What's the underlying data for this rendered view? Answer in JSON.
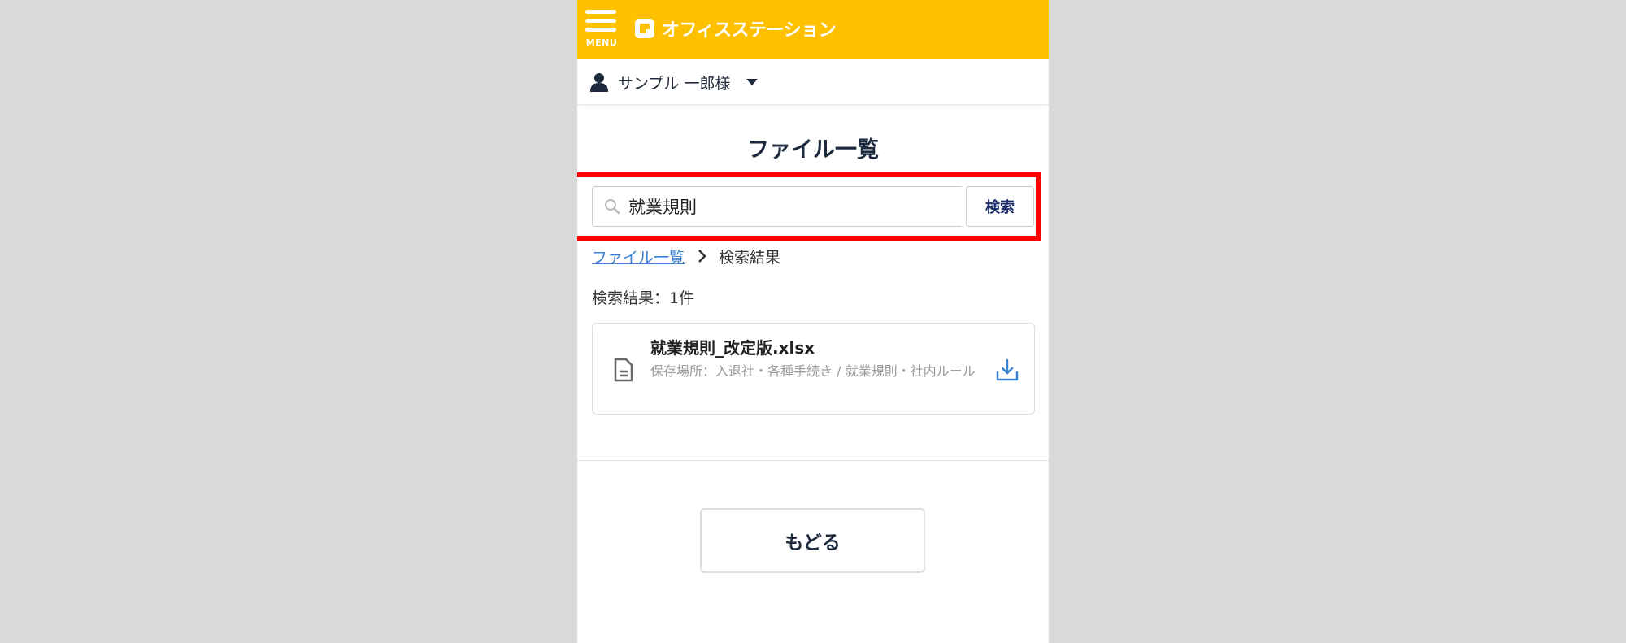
{
  "header": {
    "menu_label": "MENU",
    "logo_text": "オフィスステーション"
  },
  "user": {
    "name": "サンプル 一郎様"
  },
  "page": {
    "title": "ファイル一覧"
  },
  "search": {
    "value": "就業規則",
    "button_label": "検索"
  },
  "breadcrumb": {
    "link": "ファイル一覧",
    "current": "検索結果"
  },
  "results": {
    "count_text": "検索結果：1件",
    "files": [
      {
        "name": "就業規則_改定版.xlsx",
        "location": "保存場所：入退社・各種手続き / 就業規則・社内ルール"
      }
    ]
  },
  "footer": {
    "back_label": "もどる"
  },
  "colors": {
    "header_bg": "#ffc000",
    "highlight": "#ff0000",
    "link": "#3b82d4",
    "download_icon": "#3b82d4"
  }
}
